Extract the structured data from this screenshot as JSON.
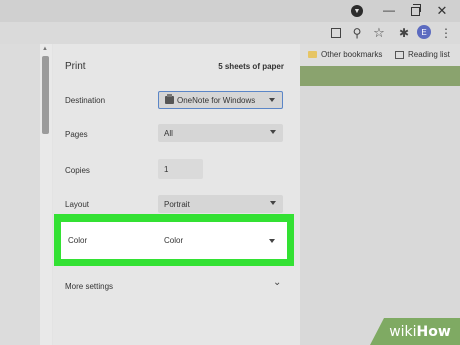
{
  "window": {
    "icons": [
      "profile-dropdown-icon",
      "minimize-icon",
      "restore-icon",
      "close-icon"
    ]
  },
  "toolbar": {
    "icons": [
      "share-icon",
      "zoom-icon",
      "star-icon",
      "extensions-icon",
      "more-menu-icon"
    ],
    "avatar_initial": "E",
    "avatar_color": "#5c6bc0"
  },
  "bookmarks": {
    "items": [
      {
        "label": "Other bookmarks",
        "icon": "folder-icon"
      },
      {
        "label": "Reading list",
        "icon": "reading-list-icon"
      }
    ]
  },
  "print_dialog": {
    "title": "Print",
    "sheets": "5 sheets of paper",
    "destination": {
      "label": "Destination",
      "value": "OneNote for Windows"
    },
    "pages": {
      "label": "Pages",
      "value": "All"
    },
    "copies": {
      "label": "Copies",
      "value": "1"
    },
    "layout": {
      "label": "Layout",
      "value": "Portrait"
    },
    "color": {
      "label": "Color",
      "value": "Color"
    },
    "more_settings": {
      "label": "More settings"
    }
  },
  "highlight": {
    "color": "#33e133"
  },
  "watermark": {
    "wiki": "wiki",
    "how": "How",
    "color": "#7faa63"
  }
}
